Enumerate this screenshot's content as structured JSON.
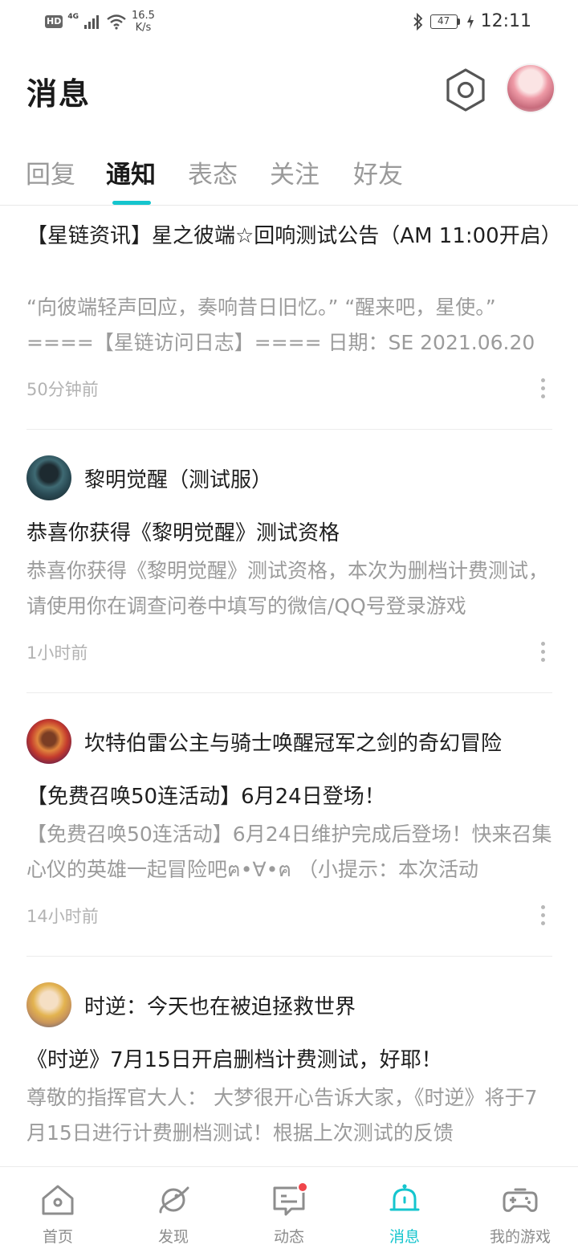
{
  "status_bar": {
    "hd": "HD",
    "network": "4G",
    "speed_value": "16.5",
    "speed_unit": "K/s",
    "battery": "47",
    "time": "12:11"
  },
  "header": {
    "title": "消息"
  },
  "tabs": [
    {
      "label": "回复",
      "active": false
    },
    {
      "label": "通知",
      "active": true
    },
    {
      "label": "表态",
      "active": false
    },
    {
      "label": "关注",
      "active": false
    },
    {
      "label": "好友",
      "active": false
    }
  ],
  "notifications": [
    {
      "source": "",
      "title": "【星链资讯】星之彼端☆回响测试公告（AM 11:00开启）",
      "body": "“向彼端轻声回应，奏响昔日旧忆。” “醒来吧，星使。” ====【星链访问日志】==== 日期：SE 2021.06.20",
      "time": "50分钟前"
    },
    {
      "source": "黎明觉醒（测试服）",
      "title": "恭喜你获得《黎明觉醒》测试资格",
      "body": "恭喜你获得《黎明觉醒》测试资格，本次为删档计费测试，请使用你在调查问卷中填写的微信/QQ号登录游戏",
      "time": "1小时前"
    },
    {
      "source": "坎特伯雷公主与骑士唤醒冠军之剑的奇幻冒险",
      "title": "【免费召唤50连活动】6月24日登场！",
      "body": "【免费召唤50连活动】6月24日维护完成后登场！快来召集心仪的英雄一起冒险吧ฅ•∀•ฅ （小提示：本次活动",
      "time": "14小时前"
    },
    {
      "source": "时逆：今天也在被迫拯救世界",
      "title": "《时逆》7月15日开启删档计费测试，好耶！",
      "body": "尊敬的指挥官大人： 大梦很开心告诉大家，《时逆》将于7月15日进行计费删档测试！根据上次测试的反馈",
      "time": ""
    }
  ],
  "bottom_nav": [
    {
      "label": "首页",
      "icon": "home-icon",
      "active": false
    },
    {
      "label": "发现",
      "icon": "planet-icon",
      "active": false
    },
    {
      "label": "动态",
      "icon": "message-icon",
      "active": false,
      "badge": true
    },
    {
      "label": "消息",
      "icon": "bell-icon",
      "active": true
    },
    {
      "label": "我的游戏",
      "icon": "gamepad-icon",
      "active": false
    }
  ],
  "colors": {
    "accent": "#15c5ce",
    "badge": "#f0454b",
    "muted_text": "#9b9b9b"
  }
}
